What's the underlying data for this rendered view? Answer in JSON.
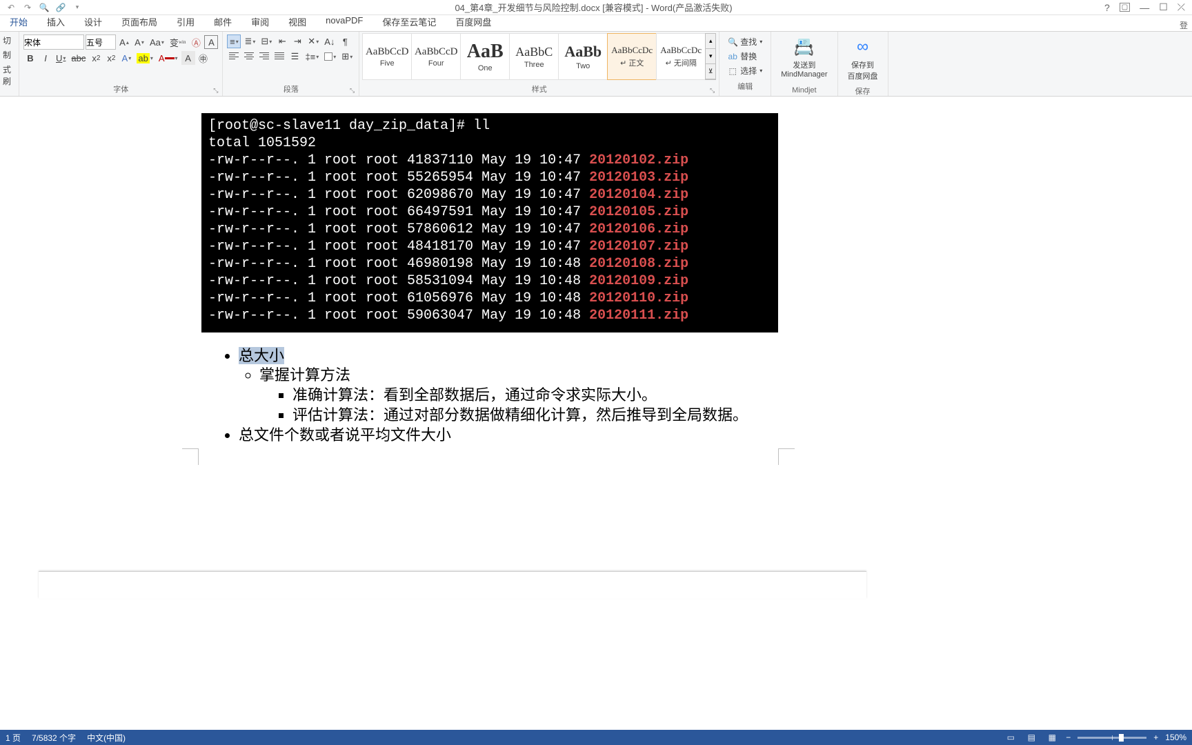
{
  "title": "04_第4章_开发细节与风险控制.docx [兼容模式] - Word(产品激活失败)",
  "tabs": [
    "开始",
    "插入",
    "设计",
    "页面布局",
    "引用",
    "邮件",
    "审阅",
    "视图",
    "novaPDF",
    "保存至云笔记",
    "百度网盘"
  ],
  "clipboard": {
    "cut": "切",
    "copy": "制",
    "brush": "式刷"
  },
  "font": {
    "name": "宋体",
    "size": "五号",
    "group_label": "字体"
  },
  "paragraph": {
    "group_label": "段落"
  },
  "styles": {
    "group_label": "样式",
    "items": [
      {
        "preview": "AaBbCcD",
        "label": "Five",
        "size": "15px"
      },
      {
        "preview": "AaBbCcD",
        "label": "Four",
        "size": "15px"
      },
      {
        "preview": "AaB",
        "label": "One",
        "size": "28px",
        "bold": true
      },
      {
        "preview": "AaBbC",
        "label": "Three",
        "size": "18px"
      },
      {
        "preview": "AaBb",
        "label": "Two",
        "size": "22px",
        "bold": true
      },
      {
        "preview": "AaBbCcDc",
        "label": "↵ 正文",
        "size": "13px",
        "selected": true
      },
      {
        "preview": "AaBbCcDc",
        "label": "↵ 无间隔",
        "size": "13px"
      }
    ]
  },
  "edit": {
    "group_label": "编辑",
    "find": "查找",
    "replace": "替换",
    "select": "选择"
  },
  "mindjet": {
    "label1": "发送到",
    "label2": "MindManager",
    "group": "Mindjet"
  },
  "baidu": {
    "label1": "保存到",
    "label2": "百度网盘",
    "group": "保存"
  },
  "terminal": {
    "prompt": "[root@sc-slave11 day_zip_data]# ll",
    "total": "total 1051592",
    "rows": [
      {
        "pre": "-rw-r--r--. 1 root root 41837110 May 19 10:47 ",
        "f": "20120102.zip"
      },
      {
        "pre": "-rw-r--r--. 1 root root 55265954 May 19 10:47 ",
        "f": "20120103.zip"
      },
      {
        "pre": "-rw-r--r--. 1 root root 62098670 May 19 10:47 ",
        "f": "20120104.zip"
      },
      {
        "pre": "-rw-r--r--. 1 root root 66497591 May 19 10:47 ",
        "f": "20120105.zip"
      },
      {
        "pre": "-rw-r--r--. 1 root root 57860612 May 19 10:47 ",
        "f": "20120106.zip"
      },
      {
        "pre": "-rw-r--r--. 1 root root 48418170 May 19 10:47 ",
        "f": "20120107.zip"
      },
      {
        "pre": "-rw-r--r--. 1 root root 46980198 May 19 10:48 ",
        "f": "20120108.zip"
      },
      {
        "pre": "-rw-r--r--. 1 root root 58531094 May 19 10:48 ",
        "f": "20120109.zip"
      },
      {
        "pre": "-rw-r--r--. 1 root root 61056976 May 19 10:48 ",
        "f": "20120110.zip"
      },
      {
        "pre": "-rw-r--r--. 1 root root 59063047 May 19 10:48 ",
        "f": "20120111.zip"
      }
    ]
  },
  "bullets": {
    "b1": "总大小",
    "b1_1": "掌握计算方法",
    "b1_1_1": "准确计算法：看到全部数据后，通过命令求实际大小。",
    "b1_1_2": "评估计算法：通过对部分数据做精细化计算，然后推导到全局数据。",
    "b2": "总文件个数或者说平均文件大小"
  },
  "status": {
    "page": "1 页",
    "words": "7/5832 个字",
    "lang": "中文(中国)",
    "zoom": "150%"
  }
}
